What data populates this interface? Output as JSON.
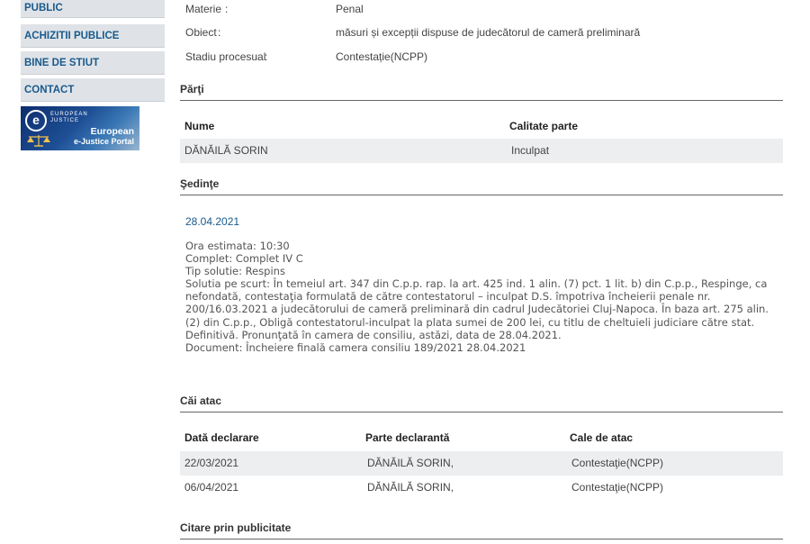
{
  "sidebar": {
    "items": [
      {
        "label": "PUBLIC"
      },
      {
        "label": "ACHIZITII PUBLICE"
      },
      {
        "label": "BINE DE STIUT"
      },
      {
        "label": "CONTACT"
      }
    ],
    "banner": {
      "logo_letter": "e",
      "small_text_1": "EUROPEAN",
      "small_text_2": "JUSTICE",
      "title_1": "European",
      "title_2": "e-Justice Portal"
    }
  },
  "case_info": [
    {
      "key": "Materie",
      "value": "Penal"
    },
    {
      "key": "Obiect",
      "value": "măsuri și excepții dispuse de judecătorul de cameră preliminară"
    },
    {
      "key": "Stadiu procesual",
      "value": "Contestație(NCPP)"
    }
  ],
  "parti": {
    "title": "Părţi",
    "headers": [
      "Nume",
      "Calitate parte"
    ],
    "rows": [
      [
        "DĂNĂILĂ SORIN",
        "Inculpat"
      ]
    ]
  },
  "sedinte": {
    "title": "Şedinţe",
    "date": "28.04.2021",
    "lines": [
      "Ora estimata: 10:30",
      "Complet: Complet IV C",
      "Tip solutie: Respins",
      "Solutia pe scurt: În temeiul art. 347 din C.p.p. rap. la art. 425 ind. 1 alin. (7) pct. 1 lit. b) din C.p.p., Respinge, ca nefondată, contestaţia formulată de către contestatorul – inculpat D.S. împotriva încheierii penale nr. 200/16.03.2021 a judecătorului de cameră preliminară din cadrul Judecătoriei Cluj-Napoca. În baza art. 275 alin. (2) din C.p.p., Obligă contestatorul-inculpat la plata sumei de 200 lei, cu titlu de cheltuieli judiciare către stat. Definitivă. Pronunţată în camera de consiliu, astăzi, data de 28.04.2021.",
      "Document: Încheiere finală camera consiliu  189/2021  28.04.2021"
    ]
  },
  "cai_atac": {
    "title": "Căi atac",
    "headers": [
      "Dată declarare",
      "Parte declarantă",
      "Cale de atac"
    ],
    "rows": [
      [
        "22/03/2021",
        "DĂNĂILĂ SORIN,",
        "Contestaţie(NCPP)"
      ],
      [
        "06/04/2021",
        "DĂNĂILĂ SORIN,",
        "Contestaţie(NCPP)"
      ]
    ]
  },
  "citare": {
    "title": "Citare prin publicitate"
  },
  "colors": {
    "link_blue": "#1a5a8c",
    "sidebar_bg": "#dfe3e7",
    "row_shade": "#eceeef"
  }
}
